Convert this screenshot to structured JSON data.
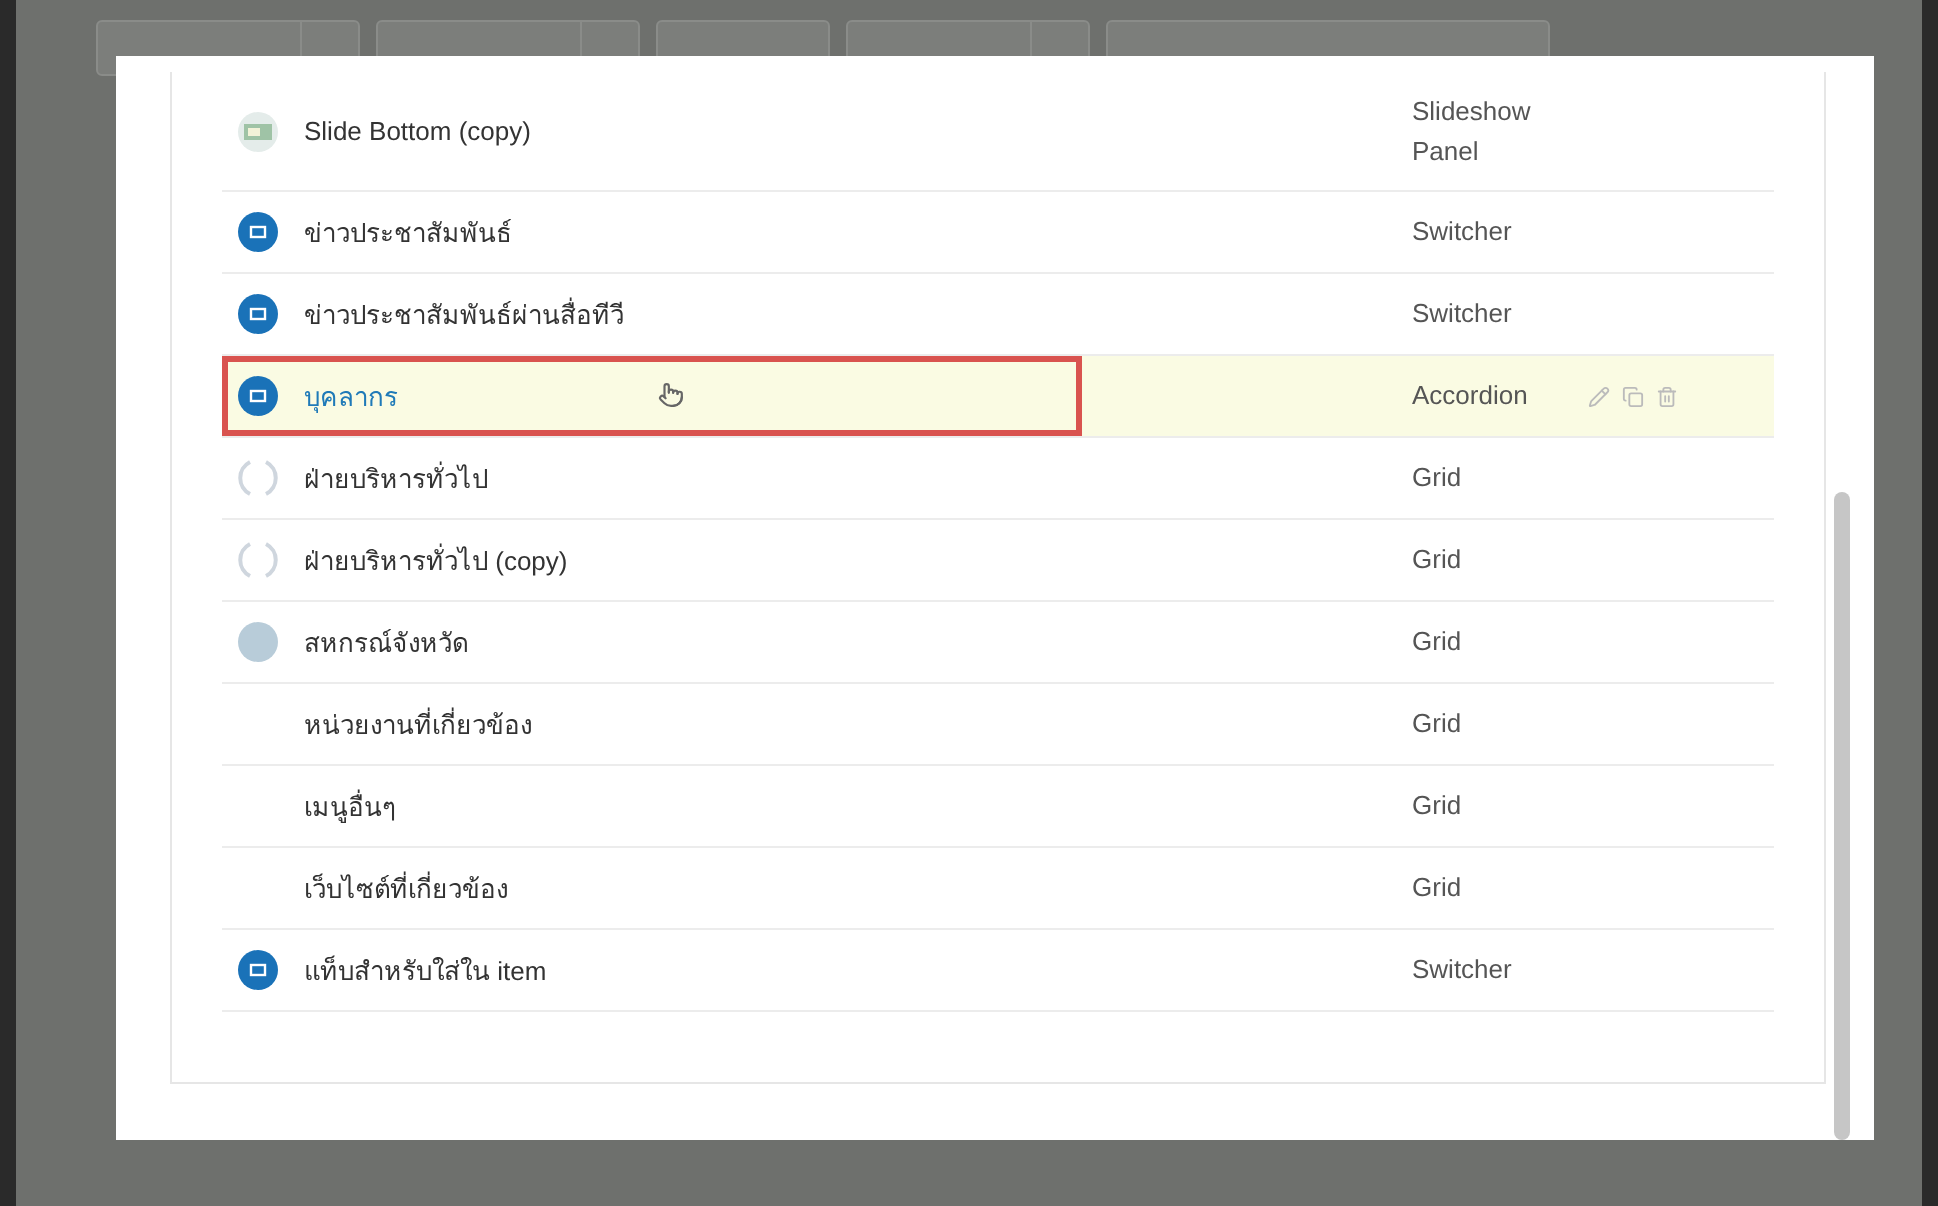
{
  "toolbar": {
    "buttons": [
      {
        "kind": "split"
      },
      {
        "kind": "split"
      },
      {
        "kind": "plain"
      },
      {
        "kind": "split"
      },
      {
        "kind": "plain"
      }
    ]
  },
  "modal": {
    "rows": [
      {
        "name": "Slide Bottom (copy)",
        "type": "Slideshow Panel",
        "kind": "thumbnail",
        "selected": false
      },
      {
        "name": "ข่าวประชาสัมพันธ์",
        "type": "Switcher",
        "kind": "badge",
        "selected": false
      },
      {
        "name": "ข่าวประชาสัมพันธ์ผ่านสื่อทีวี",
        "type": "Switcher",
        "kind": "badge",
        "selected": false
      },
      {
        "name": "บุคลากร",
        "type": "Accordion",
        "kind": "badge",
        "selected": true
      },
      {
        "name": "ฝ่ายบริหารทั่วไป",
        "type": "Grid",
        "kind": "loading",
        "selected": false
      },
      {
        "name": "ฝ่ายบริหารทั่วไป (copy)",
        "type": "Grid",
        "kind": "loading",
        "selected": false
      },
      {
        "name": "สหกรณ์จังหวัด",
        "type": "Grid",
        "kind": "photo",
        "selected": false
      },
      {
        "name": "หน่วยงานที่เกี่ยวข้อง",
        "type": "Grid",
        "kind": "plain",
        "selected": false
      },
      {
        "name": "เมนูอื่นๆ",
        "type": "Grid",
        "kind": "plain",
        "selected": false
      },
      {
        "name": "เว็บไซต์ที่เกี่ยวข้อง",
        "type": "Grid",
        "kind": "plain",
        "selected": false
      },
      {
        "name": "แท็บสำหรับใส่ใน item",
        "type": "Switcher",
        "kind": "badge",
        "selected": false
      }
    ]
  }
}
